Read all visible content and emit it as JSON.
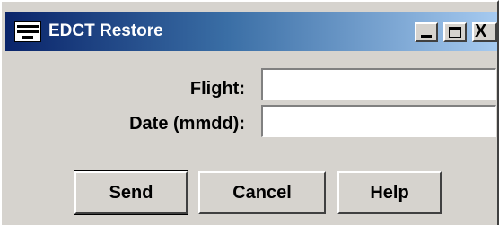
{
  "window": {
    "title": "EDCT Restore",
    "icons": {
      "system": "window-menu-icon",
      "minimize": "minimize-icon",
      "maximize": "maximize-icon",
      "close": "close-icon"
    },
    "close_glyph": "X"
  },
  "form": {
    "flight_label": "Flight:",
    "flight_value": "",
    "date_label": "Date (mmdd):",
    "date_value": ""
  },
  "buttons": {
    "send": "Send",
    "cancel": "Cancel",
    "help": "Help"
  },
  "colors": {
    "dialog_bg": "#d6d3ce",
    "title_start": "#0a246a",
    "title_end": "#a6caf0"
  }
}
